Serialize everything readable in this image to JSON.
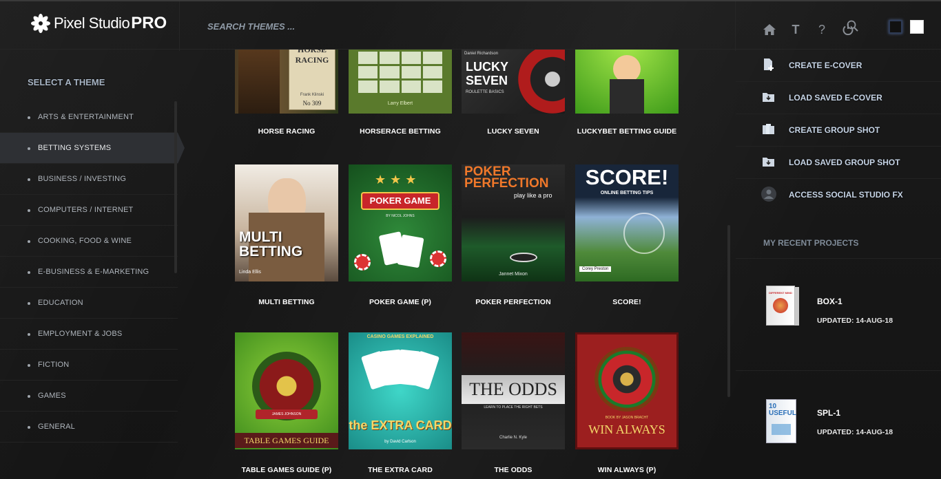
{
  "app": {
    "logo_text": "Pixel Studio",
    "logo_pro": "PRO"
  },
  "search": {
    "placeholder": "SEARCH THEMES ..."
  },
  "top_icons": [
    "home-icon",
    "text-icon",
    "help-icon",
    "power-icon"
  ],
  "top_icon_glyphs": {
    "text": "T",
    "help": "?"
  },
  "color_swatches": [
    "#111111",
    "#ffffff"
  ],
  "sidebar": {
    "title": "SELECT A THEME",
    "items": [
      {
        "label": "ARTS & ENTERTAINMENT"
      },
      {
        "label": "BETTING SYSTEMS",
        "active": true
      },
      {
        "label": "BUSINESS / INVESTING"
      },
      {
        "label": "COMPUTERS / INTERNET"
      },
      {
        "label": "COOKING, FOOD & WINE"
      },
      {
        "label": "E-BUSINESS & E-MARKETING"
      },
      {
        "label": "EDUCATION"
      },
      {
        "label": "EMPLOYMENT & JOBS"
      },
      {
        "label": "FICTION"
      },
      {
        "label": "GAMES"
      },
      {
        "label": "GENERAL"
      }
    ]
  },
  "themes": [
    {
      "label": "HORSE RACING",
      "cover_text": "HORSE RACING",
      "cover_sub": "Frank Klinski",
      "cover_extra": "No 309"
    },
    {
      "label": "HORSERACE BETTING",
      "cover_text": "",
      "cover_sub": "Larry Elbert"
    },
    {
      "label": "LUCKY SEVEN",
      "cover_text": "LUCKY SEVEN",
      "cover_sub": "ROULETTE BASICS",
      "cover_extra": "Daniel Richardson"
    },
    {
      "label": "LUCKYBET BETTING GUIDE",
      "cover_text": "",
      "cover_sub": ""
    },
    {
      "label": "MULTI BETTING",
      "cover_text": "MULTI BETTING",
      "cover_sub": "Linda Ellis"
    },
    {
      "label": "POKER GAME (P)",
      "cover_text": "POKER GAME",
      "cover_sub": "BY NICOL JOHNS"
    },
    {
      "label": "POKER PERFECTION",
      "cover_text": "POKER PERFECTION",
      "cover_sub": "play like a pro",
      "cover_extra": "Jannet Mixon"
    },
    {
      "label": "SCORE!",
      "cover_text": "SCORE!",
      "cover_sub": "ONLINE BETTING TIPS",
      "cover_extra": "Corey Preston"
    },
    {
      "label": "TABLE GAMES GUIDE (P)",
      "cover_text": "TABLE GAMES GUIDE",
      "cover_sub": "JAMES JOHNSON"
    },
    {
      "label": "THE EXTRA CARD",
      "cover_text": "the EXTRA CARD",
      "cover_sub": "CASINO GAMES EXPLAINED",
      "cover_extra": "by David Carlson"
    },
    {
      "label": "THE ODDS",
      "cover_text": "THE ODDS",
      "cover_sub": "LEARN TO PLACE THE RIGHT BETS",
      "cover_extra": "Charlie N. Kyle"
    },
    {
      "label": "WIN ALWAYS (P)",
      "cover_text": "WIN ALWAYS",
      "cover_sub": "BOOK BY JASON BRACHT"
    }
  ],
  "actions": [
    {
      "label": "CREATE E-COVER",
      "icon": "document-plus-icon"
    },
    {
      "label": "LOAD SAVED E-COVER",
      "icon": "folder-download-icon"
    },
    {
      "label": "CREATE GROUP SHOT",
      "icon": "stacked-documents-icon"
    },
    {
      "label": "LOAD SAVED GROUP SHOT",
      "icon": "folder-download-icon"
    },
    {
      "label": "ACCESS SOCIAL STUDIO FX",
      "icon": "social-studio-icon"
    }
  ],
  "recent": {
    "title": "MY RECENT PROJECTS",
    "projects": [
      {
        "name": "BOX-1",
        "updated": "UPDATED: 14-AUG-18",
        "thumb_text": "DIFFERENT MIND"
      },
      {
        "name": "SPL-1",
        "updated": "UPDATED: 14-AUG-18",
        "thumb_text": "10 USEFUL"
      }
    ]
  }
}
